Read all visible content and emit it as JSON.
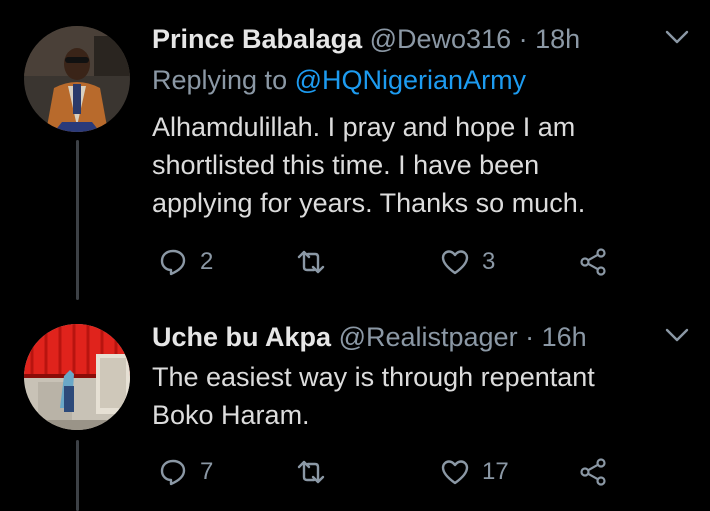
{
  "tweets": [
    {
      "name": "Prince Babalaga",
      "handle": "@Dewo316",
      "time": "18h",
      "separator": "·",
      "replying_prefix": "Replying to",
      "replying_to": "@HQNigerianArmy",
      "text": "Alhamdulillah. I pray and hope I am shortlisted this time. I have been applying for years. Thanks so much.",
      "text_lines": [
        "Alhamdulillah. I pray and hope I am",
        "shortlisted this time. I have been",
        "applying for years. Thanks so much."
      ],
      "replies": "2",
      "retweets": "",
      "likes": "3"
    },
    {
      "name": "Uche bu Akpa",
      "handle": "@Realistpager",
      "time": "16h",
      "separator": "·",
      "text_lines": [
        "The easiest way is through repentant",
        "Boko Haram."
      ],
      "replies": "7",
      "retweets": "",
      "likes": "17"
    }
  ],
  "colors": {
    "background": "#000000",
    "name": "#e6e6e6",
    "meta": "#8b98a5",
    "mention": "#1d9bf0",
    "thread_line": "#3d4146"
  },
  "icons": [
    "chevron-down-icon",
    "reply-icon",
    "retweet-icon",
    "heart-icon",
    "share-icon"
  ]
}
